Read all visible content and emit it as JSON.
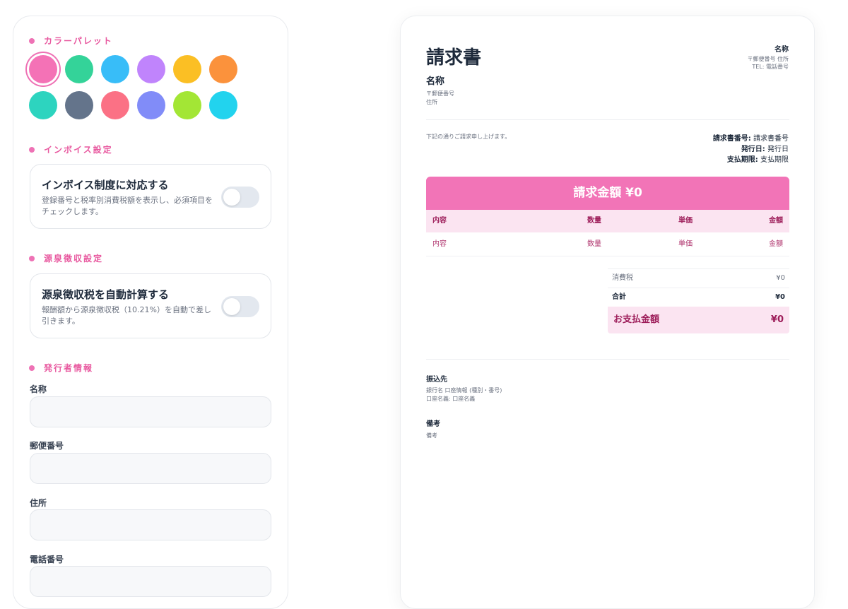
{
  "settings": {
    "palette": {
      "heading": "カラーパレット",
      "selected_index": 0,
      "colors": [
        "#f472b6",
        "#34d399",
        "#38bdf8",
        "#c084fc",
        "#fbbf24",
        "#fb923c",
        "#2dd4bf",
        "#64748b",
        "#fb7185",
        "#818cf8",
        "#a3e635",
        "#22d3ee"
      ]
    },
    "invoice_section": {
      "heading": "インボイス設定",
      "toggle_title": "インボイス制度に対応する",
      "toggle_desc": "登録番号と税率別消費税額を表示し、必須項目をチェックします。",
      "enabled": false
    },
    "withholding_section": {
      "heading": "源泉徴収設定",
      "toggle_title": "源泉徴収税を自動計算する",
      "toggle_desc": "報酬額から源泉徴収税（10.21%）を自動で差し引きます。",
      "enabled": false
    },
    "issuer_section": {
      "heading": "発行者情報",
      "fields": [
        {
          "label": "名称",
          "value": ""
        },
        {
          "label": "郵便番号",
          "value": ""
        },
        {
          "label": "住所",
          "value": ""
        },
        {
          "label": "電話番号",
          "value": ""
        }
      ]
    }
  },
  "invoice": {
    "title": "請求書",
    "client_name": "名称",
    "client_postal": "〒郵便番号",
    "client_address": "住所",
    "issuer_name": "名称",
    "issuer_line1": "〒郵便番号 住所",
    "issuer_line2": "TEL: 電話番号",
    "greeting": "下記の通りご請求申し上げます。",
    "meta": {
      "number_label": "請求書番号:",
      "number_value": "請求書番号",
      "date_label": "発行日:",
      "date_value": "発行日",
      "due_label": "支払期限:",
      "due_value": "支払期限"
    },
    "total_banner": "請求金額 ¥0",
    "table": {
      "headers": [
        "内容",
        "数量",
        "単価",
        "金額"
      ],
      "rows": [
        [
          "内容",
          "数量",
          "単価",
          "金額"
        ]
      ]
    },
    "summary": {
      "tax_label": "消費税",
      "tax_value": "¥0",
      "subtotal_label": "合計",
      "subtotal_value": "¥0",
      "pay_label": "お支払金額",
      "pay_value": "¥0"
    },
    "bank": {
      "title": "振込先",
      "line1": "銀行名 口座情報 (種別・番号)",
      "line2": "口座名義: 口座名義"
    },
    "notes": {
      "title": "備考",
      "body": "備考"
    },
    "accent_color": "#f274b7"
  }
}
